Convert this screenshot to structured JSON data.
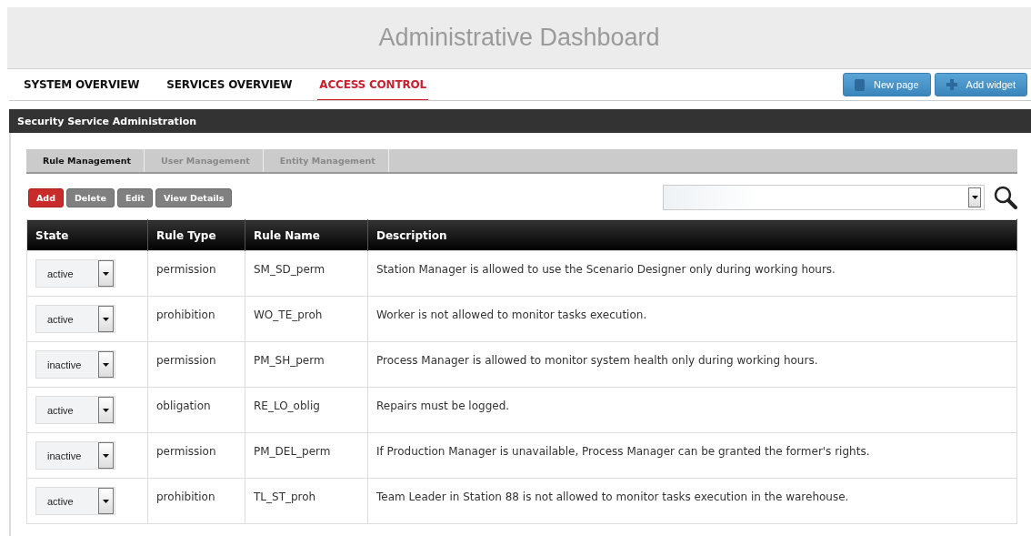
{
  "header": {
    "title": "Administrative Dashboard"
  },
  "nav": {
    "tabs": [
      {
        "label": "SYSTEM OVERVIEW",
        "selected": false
      },
      {
        "label": "SERVICES OVERVIEW",
        "selected": false
      },
      {
        "label": "ACCESS CONTROL",
        "selected": true
      }
    ],
    "actions": [
      {
        "kind": "page",
        "label": "New page"
      },
      {
        "kind": "add",
        "label": "Add widget"
      }
    ]
  },
  "panel": {
    "title": "Security Service Administration",
    "tabs": [
      {
        "label": "Rule Management",
        "selected": true
      },
      {
        "label": "User Management",
        "selected": false
      },
      {
        "label": "Entity Management",
        "selected": false
      }
    ],
    "buttons": [
      {
        "kind": "primary",
        "label": "Add"
      },
      {
        "kind": "default",
        "label": "Delete"
      },
      {
        "kind": "default",
        "label": "Edit"
      },
      {
        "kind": "default",
        "label": "View Details"
      }
    ],
    "table": {
      "columns": [
        "State",
        "Rule Type",
        "Rule Name",
        "Description"
      ],
      "rows": [
        {
          "state": "active",
          "type": "permission",
          "name": "SM_SD_perm",
          "description": "Station Manager is allowed to use the Scenario Designer only during working hours."
        },
        {
          "state": "active",
          "type": "prohibition",
          "name": "WO_TE_proh",
          "description": "Worker is not allowed to monitor tasks execution."
        },
        {
          "state": "inactive",
          "type": "permission",
          "name": "PM_SH_perm",
          "description": "Process Manager is allowed to monitor system health only during working hours."
        },
        {
          "state": "active",
          "type": "obligation",
          "name": "RE_LO_oblig",
          "description": "Repairs must be logged."
        },
        {
          "state": "inactive",
          "type": "permission",
          "name": "PM_DEL_perm",
          "description": "If Production Manager is unavailable, Process Manager can be granted the former's rights."
        },
        {
          "state": "active",
          "type": "prohibition",
          "name": "TL_ST_proh",
          "description": "Team Leader in Station 88 is not allowed to monitor tasks execution in the warehouse."
        }
      ]
    }
  }
}
